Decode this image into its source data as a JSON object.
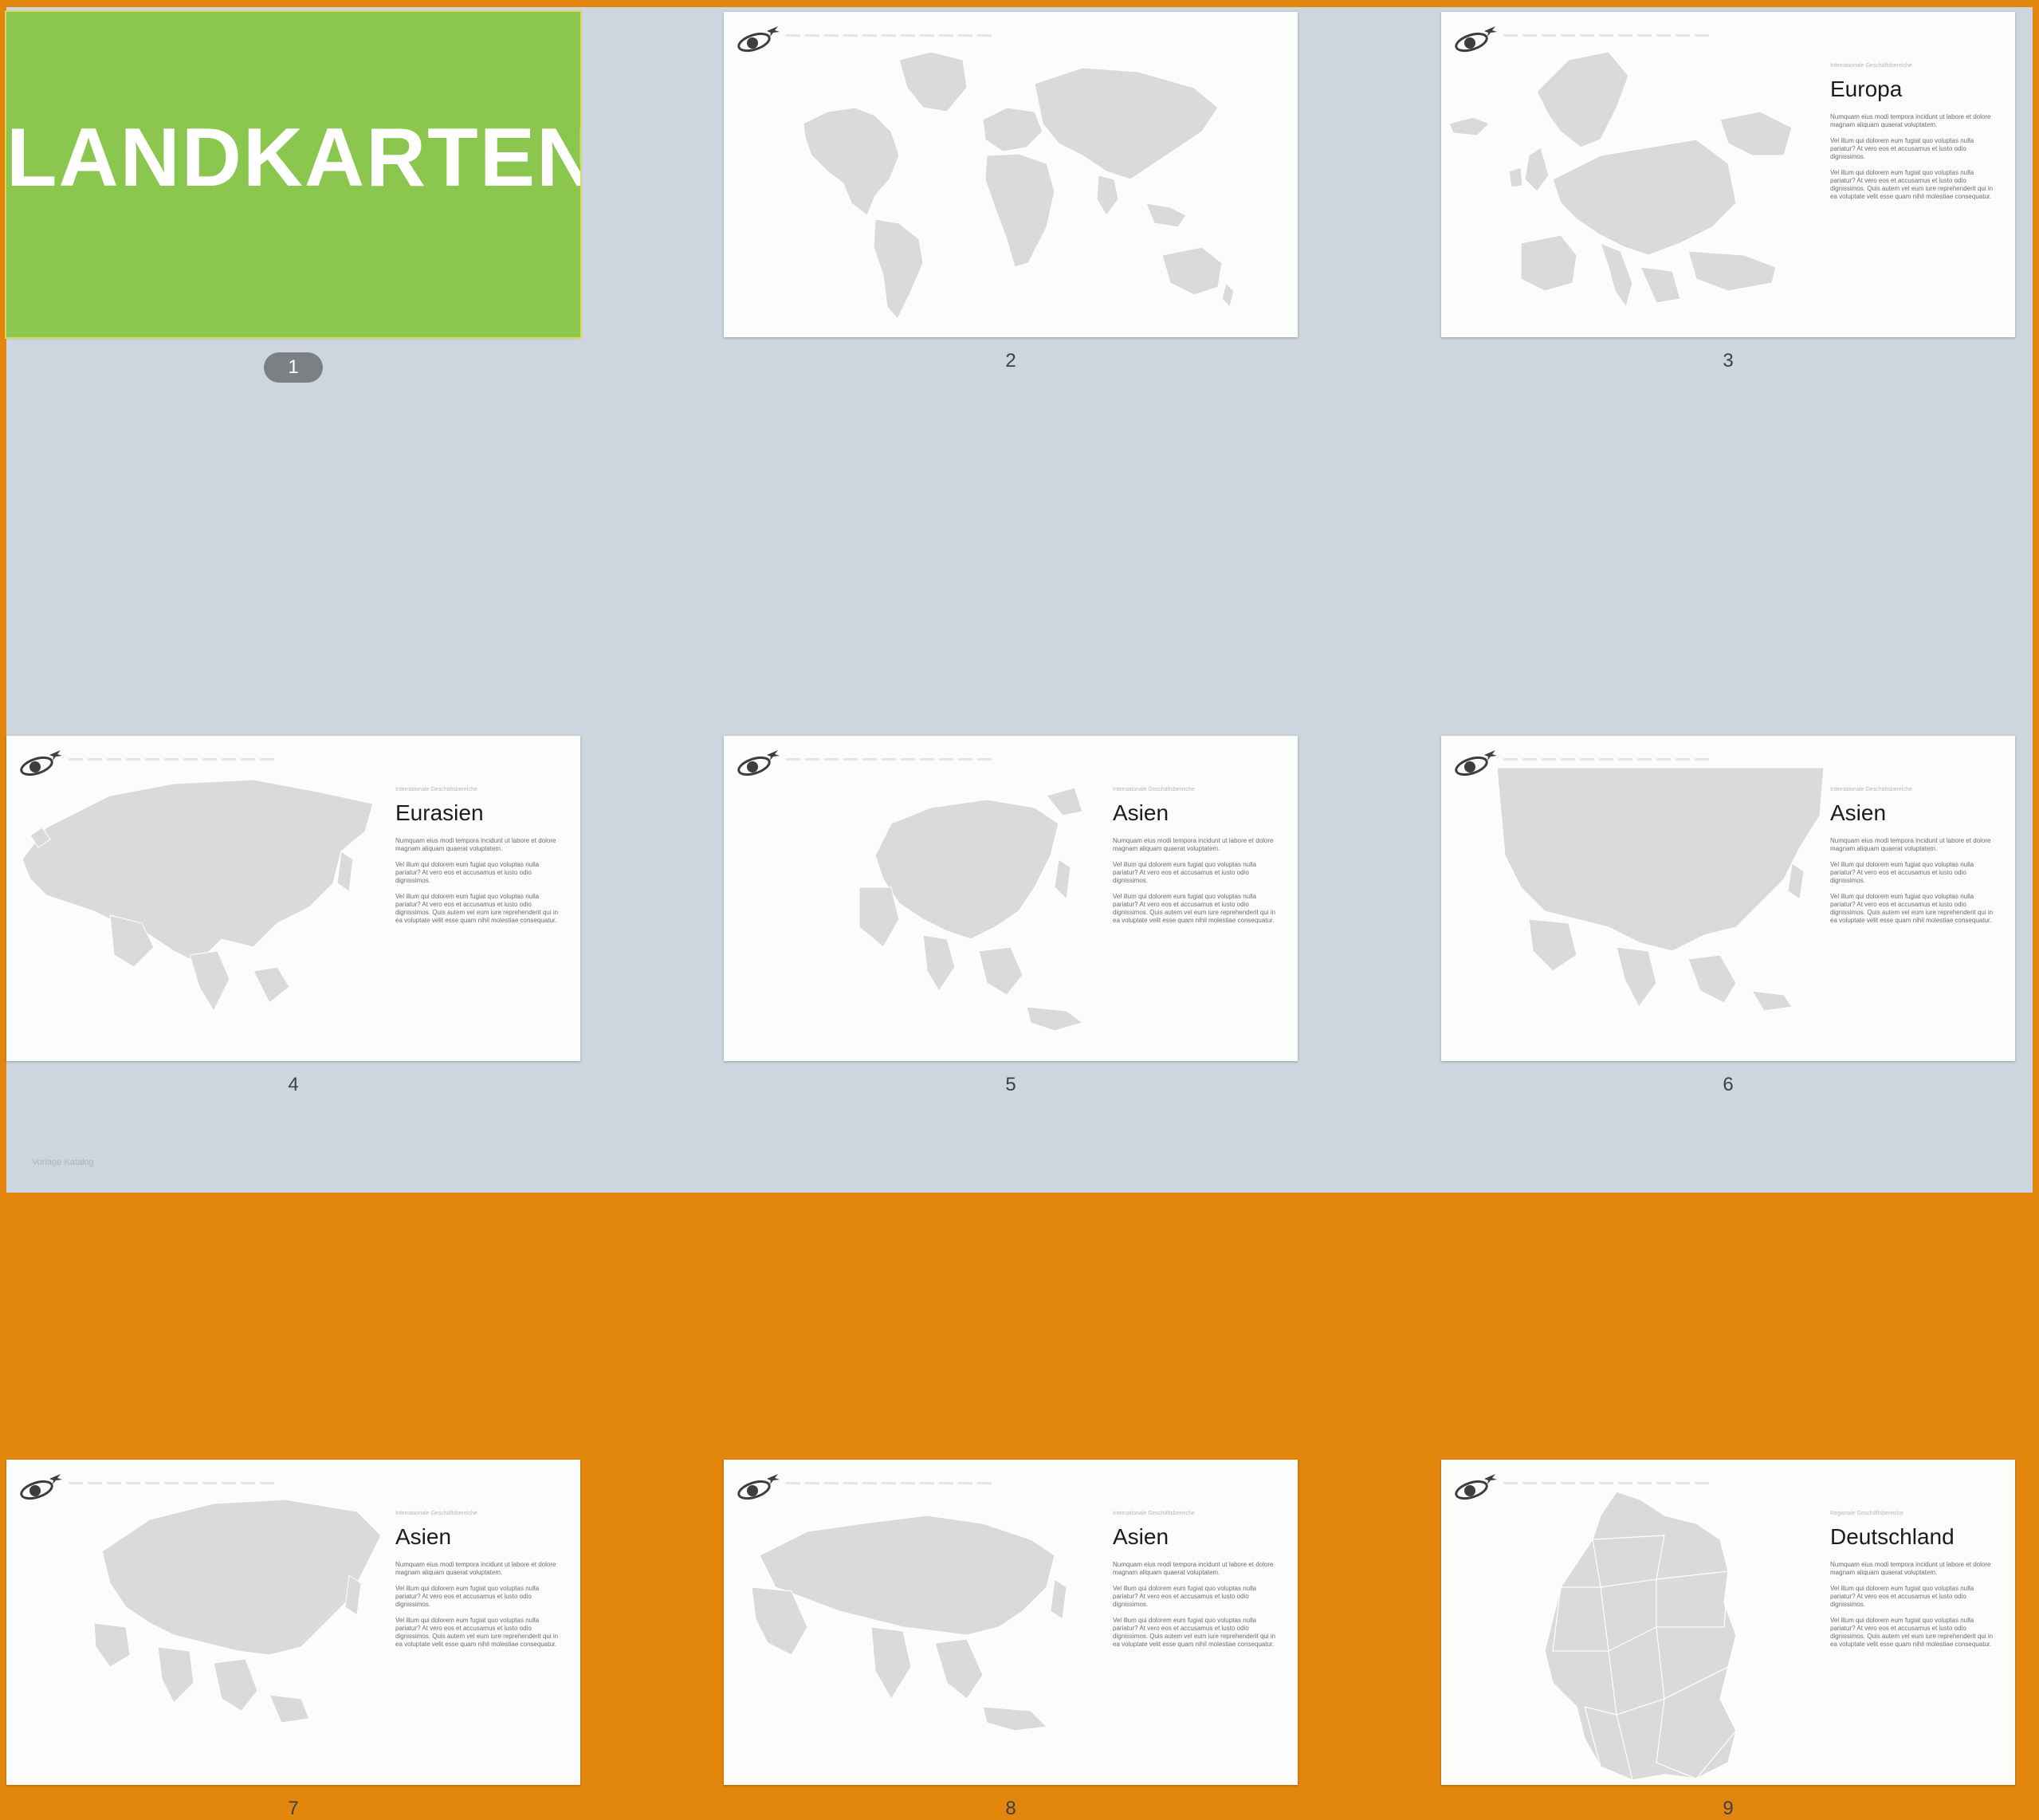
{
  "title_slide": {
    "number": "1",
    "text": "LANDKARTEN"
  },
  "colors": {
    "title_green": "#8bc74e",
    "map_gray": "#dadbd8",
    "selection_badge": "#7c7f83",
    "window_border": "#e3860e"
  },
  "logo_icon": "globe-plane-icon",
  "slides": [
    {
      "number": "2",
      "map": "world-map",
      "has_text": false
    },
    {
      "number": "3",
      "map": "europe-map",
      "has_text": true,
      "kicker": "Internationale Geschäftsbereiche",
      "heading": "Europa",
      "paragraphs": [
        "Numquam eius modi tempora incidunt ut labore et dolore magnam aliquam quaerat voluptatem.",
        "Vel illum qui dolorem eum fugiat quo voluptas nulla pariatur? At vero eos et accusamus et iusto odio dignissimos.",
        "Vel illum qui dolorem eum fugiat quo voluptas nulla pariatur? At vero eos et accusamus et iusto odio dignissimos. Quis autem vel eum iure reprehenderit qui in ea voluptate velit esse quam nihil molestiae consequatur."
      ]
    },
    {
      "number": "4",
      "map": "eurasia-map",
      "has_text": true,
      "kicker": "Internationale Geschäftsbereiche",
      "heading": "Eurasien",
      "paragraphs": [
        "Numquam eius modi tempora incidunt ut labore et dolore magnam aliquam quaerat voluptatem.",
        "Vel illum qui dolorem eum fugiat quo voluptas nulla pariatur? At vero eos et accusamus et iusto odio dignissimos.",
        "Vel illum qui dolorem eum fugiat quo voluptas nulla pariatur? At vero eos et accusamus et iusto odio dignissimos. Quis autem vel eum iure reprehenderit qui in ea voluptate velit esse quam nihil molestiae consequatur."
      ]
    },
    {
      "number": "5",
      "map": "asia-map",
      "has_text": true,
      "kicker": "Internationale Geschäftsbereiche",
      "heading": "Asien",
      "paragraphs": [
        "Numquam eius modi tempora incidunt ut labore et dolore magnam aliquam quaerat voluptatem.",
        "Vel illum qui dolorem eum fugiat quo voluptas nulla pariatur? At vero eos et accusamus et iusto odio dignissimos.",
        "Vel illum qui dolorem eum fugiat quo voluptas nulla pariatur? At vero eos et accusamus et iusto odio dignissimos. Quis autem vel eum iure reprehenderit qui in ea voluptate velit esse quam nihil molestiae consequatur."
      ]
    },
    {
      "number": "6",
      "map": "asia-map-wide",
      "has_text": true,
      "kicker": "Internationale Geschäftsbereiche",
      "heading": "Asien",
      "paragraphs": [
        "Numquam eius modi tempora incidunt ut labore et dolore magnam aliquam quaerat voluptatem.",
        "Vel illum qui dolorem eum fugiat quo voluptas nulla pariatur? At vero eos et accusamus et iusto odio dignissimos.",
        "Vel illum qui dolorem eum fugiat quo voluptas nulla pariatur? At vero eos et accusamus et iusto odio dignissimos. Quis autem vel eum iure reprehenderit qui in ea voluptate velit esse quam nihil molestiae consequatur."
      ]
    },
    {
      "number": "7",
      "map": "asia-map-russia",
      "has_text": true,
      "kicker": "Internationale Geschäftsbereiche",
      "heading": "Asien",
      "paragraphs": [
        "Numquam eius modi tempora incidunt ut labore et dolore magnam aliquam quaerat voluptatem.",
        "Vel illum qui dolorem eum fugiat quo voluptas nulla pariatur? At vero eos et accusamus et iusto odio dignissimos.",
        "Vel illum qui dolorem eum fugiat quo voluptas nulla pariatur? At vero eos et accusamus et iusto odio dignissimos. Quis autem vel eum iure reprehenderit qui in ea voluptate velit esse quam nihil molestiae consequatur."
      ]
    },
    {
      "number": "8",
      "map": "asia-map-south",
      "has_text": true,
      "kicker": "Internationale Geschäftsbereiche",
      "heading": "Asien",
      "paragraphs": [
        "Numquam eius modi tempora incidunt ut labore et dolore magnam aliquam quaerat voluptatem.",
        "Vel illum qui dolorem eum fugiat quo voluptas nulla pariatur? At vero eos et accusamus et iusto odio dignissimos.",
        "Vel illum qui dolorem eum fugiat quo voluptas nulla pariatur? At vero eos et accusamus et iusto odio dignissimos. Quis autem vel eum iure reprehenderit qui in ea voluptate velit esse quam nihil molestiae consequatur."
      ]
    },
    {
      "number": "9",
      "map": "germany-map",
      "has_text": true,
      "kicker": "Regionale Geschäftsbereiche",
      "heading": "Deutschland",
      "paragraphs": [
        "Numquam eius modi tempora incidunt ut labore et dolore magnam aliquam quaerat voluptatem.",
        "Vel illum qui dolorem eum fugiat quo voluptas nulla pariatur? At vero eos et accusamus et iusto odio dignissimos.",
        "Vel illum qui dolorem eum fugiat quo voluptas nulla pariatur? At vero eos et accusamus et iusto odio dignissimos. Quis autem vel eum iure reprehenderit qui in ea voluptate velit esse quam nihil molestiae consequatur."
      ]
    }
  ],
  "footer_note": "Vorlage Katalog"
}
